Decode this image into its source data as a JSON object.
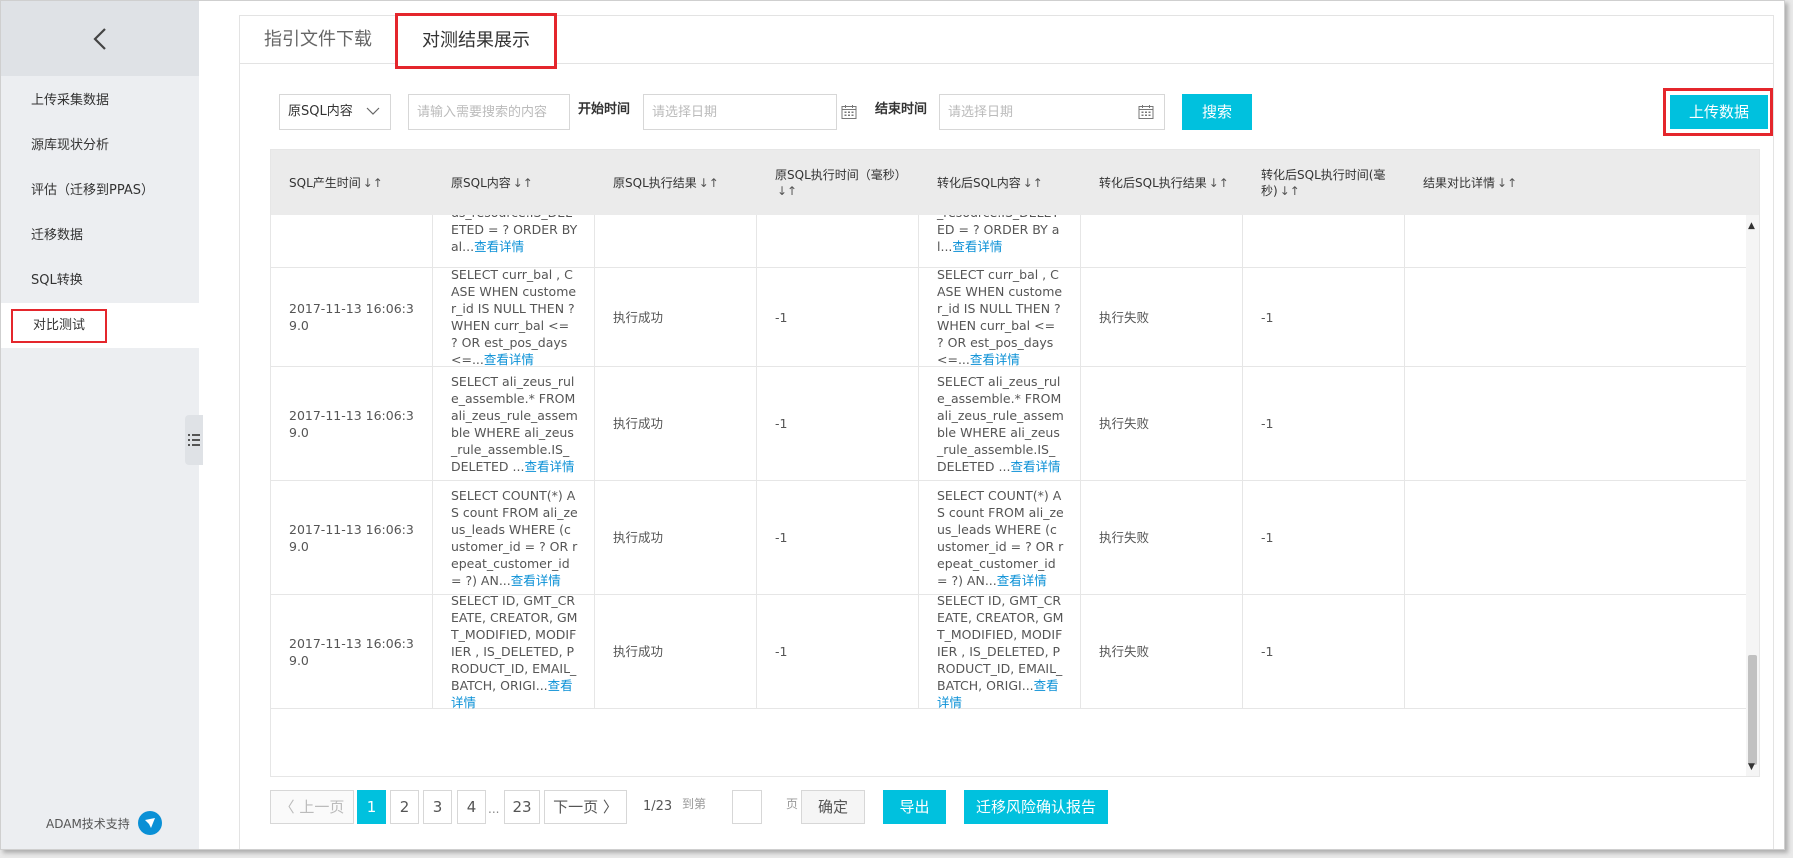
{
  "sidebar": {
    "items": [
      {
        "label": "上传采集数据"
      },
      {
        "label": "源库现状分析"
      },
      {
        "label": "评估（迁移到PPAS）"
      },
      {
        "label": "迁移数据"
      },
      {
        "label": "SQL转换"
      },
      {
        "label": "对比测试"
      }
    ],
    "active_index": 5,
    "support_label": "ADAM技术支持"
  },
  "tabs": [
    {
      "label": "指引文件下载"
    },
    {
      "label": "对测结果展示"
    }
  ],
  "filters": {
    "select_value": "原SQL内容",
    "search_placeholder": "请输入需要搜索的内容",
    "start_label": "开始时间",
    "start_placeholder": "请选择日期",
    "end_label": "结束时间",
    "end_placeholder": "请选择日期",
    "search_button": "搜索",
    "upload_button": "上传数据"
  },
  "table": {
    "headers": [
      "SQL产生时间",
      "原SQL内容",
      "原SQL执行结果",
      "原SQL执行时间（毫秒）",
      "转化后SQL内容",
      "转化后SQL执行结果",
      "转化后SQL执行时间(毫秒)",
      "结果对比详情"
    ],
    "sort_glyph": "↓↑",
    "detail_label": "查看详情",
    "partial_row": {
      "orig_sql": "us_resource.IS_DELETED = ? ORDER BY al...",
      "conv_sql": "_resource.IS_DELETED = ? ORDER BY al..."
    },
    "rows": [
      {
        "time": "2017-11-13 16:06:39.0",
        "orig_sql": "SELECT curr_bal , CASE WHEN customer_id IS NULL THEN ? WHEN curr_bal <= ? OR est_pos_days <=...",
        "orig_result": "执行成功",
        "orig_time": "-1",
        "conv_sql": "SELECT curr_bal , CASE WHEN customer_id IS NULL THEN ? WHEN curr_bal <= ? OR est_pos_days <=...",
        "conv_result": "执行失败",
        "conv_time": "-1",
        "compare": ""
      },
      {
        "time": "2017-11-13 16:06:39.0",
        "orig_sql": "SELECT ali_zeus_rule_assemble.* FROM ali_zeus_rule_assemble WHERE ali_zeus_rule_assemble.IS_DELETED ...",
        "orig_result": "执行成功",
        "orig_time": "-1",
        "conv_sql": "SELECT ali_zeus_rule_assemble.* FROM ali_zeus_rule_assemble WHERE ali_zeus_rule_assemble.IS_DELETED ...",
        "conv_result": "执行失败",
        "conv_time": "-1",
        "compare": ""
      },
      {
        "time": "2017-11-13 16:06:39.0",
        "orig_sql": "SELECT COUNT(*) AS count FROM ali_zeus_leads WHERE (customer_id = ? OR repeat_customer_id = ?) AN...",
        "orig_result": "执行成功",
        "orig_time": "-1",
        "conv_sql": "SELECT COUNT(*) AS count FROM ali_zeus_leads WHERE (customer_id = ? OR repeat_customer_id = ?) AN...",
        "conv_result": "执行失败",
        "conv_time": "-1",
        "compare": ""
      },
      {
        "time": "2017-11-13 16:06:39.0",
        "orig_sql": "SELECT ID, GMT_CREATE, CREATOR, GMT_MODIFIED, MODIFIER , IS_DELETED, PRODUCT_ID, EMAIL_BATCH, ORIGI...",
        "orig_result": "执行成功",
        "orig_time": "-1",
        "conv_sql": "SELECT ID, GMT_CREATE, CREATOR, GMT_MODIFIED, MODIFIER , IS_DELETED, PRODUCT_ID, EMAIL_BATCH, ORIGI...",
        "conv_result": "执行失败",
        "conv_time": "-1",
        "compare": ""
      }
    ]
  },
  "pager": {
    "prev": "上一页",
    "pages": [
      "1",
      "2",
      "3",
      "4",
      "23"
    ],
    "ellipsis": "...",
    "next": "下一页",
    "count": "1/23",
    "goto_label": "到第",
    "page_label": "页",
    "confirm": "确定",
    "export": "导出",
    "report": "迁移风险确认报告"
  }
}
